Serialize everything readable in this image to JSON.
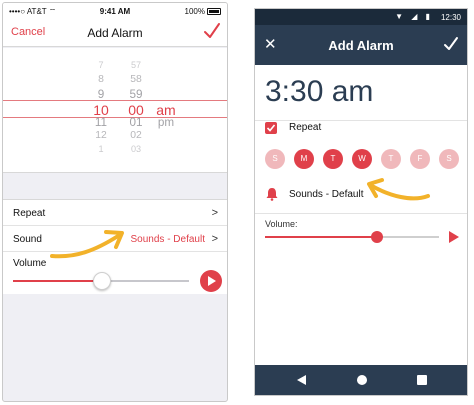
{
  "colors": {
    "accent": "#e0404a",
    "android_bar": "#2b3d52",
    "arrow": "#f2b22a"
  },
  "ios": {
    "status": {
      "carrier": "••••○ AT&T ⌔",
      "time": "9:41 AM",
      "battery": "100%"
    },
    "nav": {
      "cancel": "Cancel",
      "title": "Add Alarm",
      "done_icon": "checkmark-icon"
    },
    "picker": {
      "hours": [
        "7",
        "8",
        "9",
        "10",
        "11",
        "12",
        "1"
      ],
      "minutes": [
        "57",
        "58",
        "59",
        "00",
        "01",
        "02",
        "03"
      ],
      "ampm": [
        "am",
        "pm"
      ],
      "selected": {
        "hour": "10",
        "minute": "00",
        "ampm": "am"
      }
    },
    "rows": {
      "repeat_label": "Repeat",
      "sound_label": "Sound",
      "sound_value": "Sounds - Default",
      "chevron": ">"
    },
    "volume": {
      "label": "Volume",
      "level": 0.45,
      "play_icon": "play-icon"
    }
  },
  "android": {
    "nav": {
      "close": "✕",
      "title": "Add Alarm",
      "done_icon": "checkmark-icon"
    },
    "time": "3:30 am",
    "repeat": {
      "label": "Repeat",
      "checked": true
    },
    "days": [
      {
        "letter": "S",
        "on": false
      },
      {
        "letter": "M",
        "on": true
      },
      {
        "letter": "T",
        "on": true
      },
      {
        "letter": "W",
        "on": true
      },
      {
        "letter": "T",
        "on": false
      },
      {
        "letter": "F",
        "on": false
      },
      {
        "letter": "S",
        "on": false
      }
    ],
    "sound": {
      "label": "Sounds - Default",
      "icon": "bell-icon"
    },
    "volume": {
      "label": "Volume:",
      "level": 0.65,
      "play_icon": "play-icon"
    },
    "navbar": [
      "back-icon",
      "home-icon",
      "recents-icon"
    ]
  }
}
